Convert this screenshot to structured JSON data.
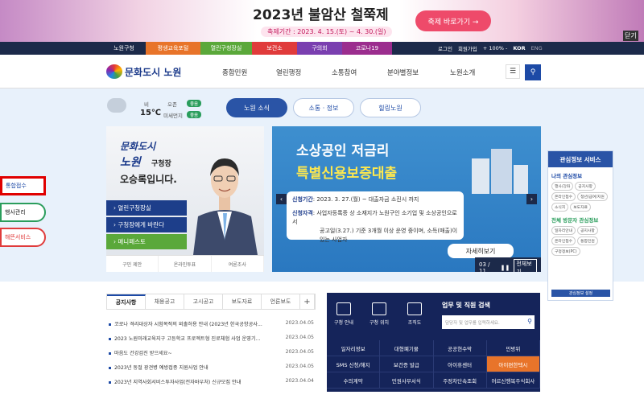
{
  "banner": {
    "title": "2023년 불암산 철쭉제",
    "period": "축제기간 : 2023. 4. 15.(토) ~ 4. 30.(일)",
    "cta": "축제 바로가기 →",
    "close": "닫기"
  },
  "topbar": {
    "tabs": [
      {
        "label": "노원구청",
        "color": "#1c2a4a"
      },
      {
        "label": "평생교육포털",
        "color": "#e8742a"
      },
      {
        "label": "열린구청장실",
        "color": "#5aa83a"
      },
      {
        "label": "보건소",
        "color": "#e03b3b"
      },
      {
        "label": "구의회",
        "color": "#7a3fb0"
      },
      {
        "label": "코로나19",
        "color": "#9b2d8e"
      }
    ],
    "login": "로그인",
    "join": "회원가입",
    "zoom": "+ 100% -",
    "lang_kor": "KOR",
    "lang_eng": "ENG"
  },
  "header": {
    "logo": "문화도시 노원",
    "menu": [
      "종합민원",
      "열린행정",
      "소통참여",
      "분야별정보",
      "노원소개"
    ]
  },
  "weather": {
    "condition": "비",
    "temp": "15℃",
    "ozone_label": "오존",
    "ozone_status": "좋음",
    "dust_label": "미세먼지",
    "dust_status": "좋음"
  },
  "portal_tabs": [
    "노원 소식",
    "소통 · 정보",
    "힐링노원"
  ],
  "mayor": {
    "caption1": "문화도시",
    "caption2": "노원",
    "caption2b": "구청장",
    "caption3": "오승록입니다.",
    "links": [
      "열린구청장실",
      "구청장에게 바란다",
      "매니페스토"
    ],
    "footer": [
      "구민 제안",
      "온라인투표",
      "여론조사"
    ]
  },
  "slide": {
    "title1": "소상공인 저금리",
    "title2": "특별신용보증대출",
    "period_label": "신청기간",
    "period": ": 2023. 3. 27.(월) ~ 대출자금 소진시 까지",
    "qual_label": "신청자격",
    "qual1": ": 사업자등록증 상 소재지가 노원구인 소기업 및 소상공인으로서",
    "qual2": "공고일(3.27.) 기준 3개월 이상 운영 중이며, 소득(매출)이 있는 사업자",
    "more": "자세히보기",
    "pager": "03 / 11",
    "pager_all": "전체보기"
  },
  "side": [
    "통합접수",
    "행사관리",
    "해뜬서비스"
  ],
  "quick": {
    "title": "관심정보 서비스",
    "my_title": "나의 관심정보",
    "my_chips": [
      "행사/강좌",
      "공지사항",
      "온라인접수",
      "청년/급여/지원",
      "소식지",
      "보도자료"
    ],
    "all_title": "전체 방문자 관심정보",
    "all_chips": [
      "일자리안내",
      "공지사항",
      "온라인접수",
      "통합민원",
      "구정정보(PC)"
    ],
    "bottom": "관심정보 설정"
  },
  "notice": {
    "tabs": [
      "공지사항",
      "채용공고",
      "고시공고",
      "보도자료",
      "언론보도"
    ],
    "items": [
      {
        "title": "코로나 격리대상자 시험목적의 외출허용 안내 (2023년 한국공항공사...",
        "date": "2023.04.05"
      },
      {
        "title": "2023 노원미래교육지구 고등학교 프로젝트형 진로체험 사업 운영기...",
        "date": "2023.04.05"
      },
      {
        "title": "마음도 건강검진 받으세요~",
        "date": "2023.04.05"
      },
      {
        "title": "2023년 동절 광견병 예방접종 지원사업 안내",
        "date": "2023.04.05"
      },
      {
        "title": "2023년 지역사회서비스투자사업(전자바우처) 신규모집 안내",
        "date": "2023.04.04"
      }
    ]
  },
  "task": {
    "icons": [
      "구청 안내",
      "구청 위치",
      "조직도"
    ],
    "search_title": "업무 및 직원 검색",
    "search_placeholder": "담당자 및 업무를 입력하세요.",
    "grid": [
      "일자리정보",
      "대형폐기물",
      "공공현수막",
      "민방위",
      "SMS 신청/해지",
      "보건증 발급",
      "아이휴센터",
      "아이편한텍시",
      "수의계약",
      "민원사무서식",
      "주정차단속조회",
      "어르신행복주식회사"
    ]
  }
}
